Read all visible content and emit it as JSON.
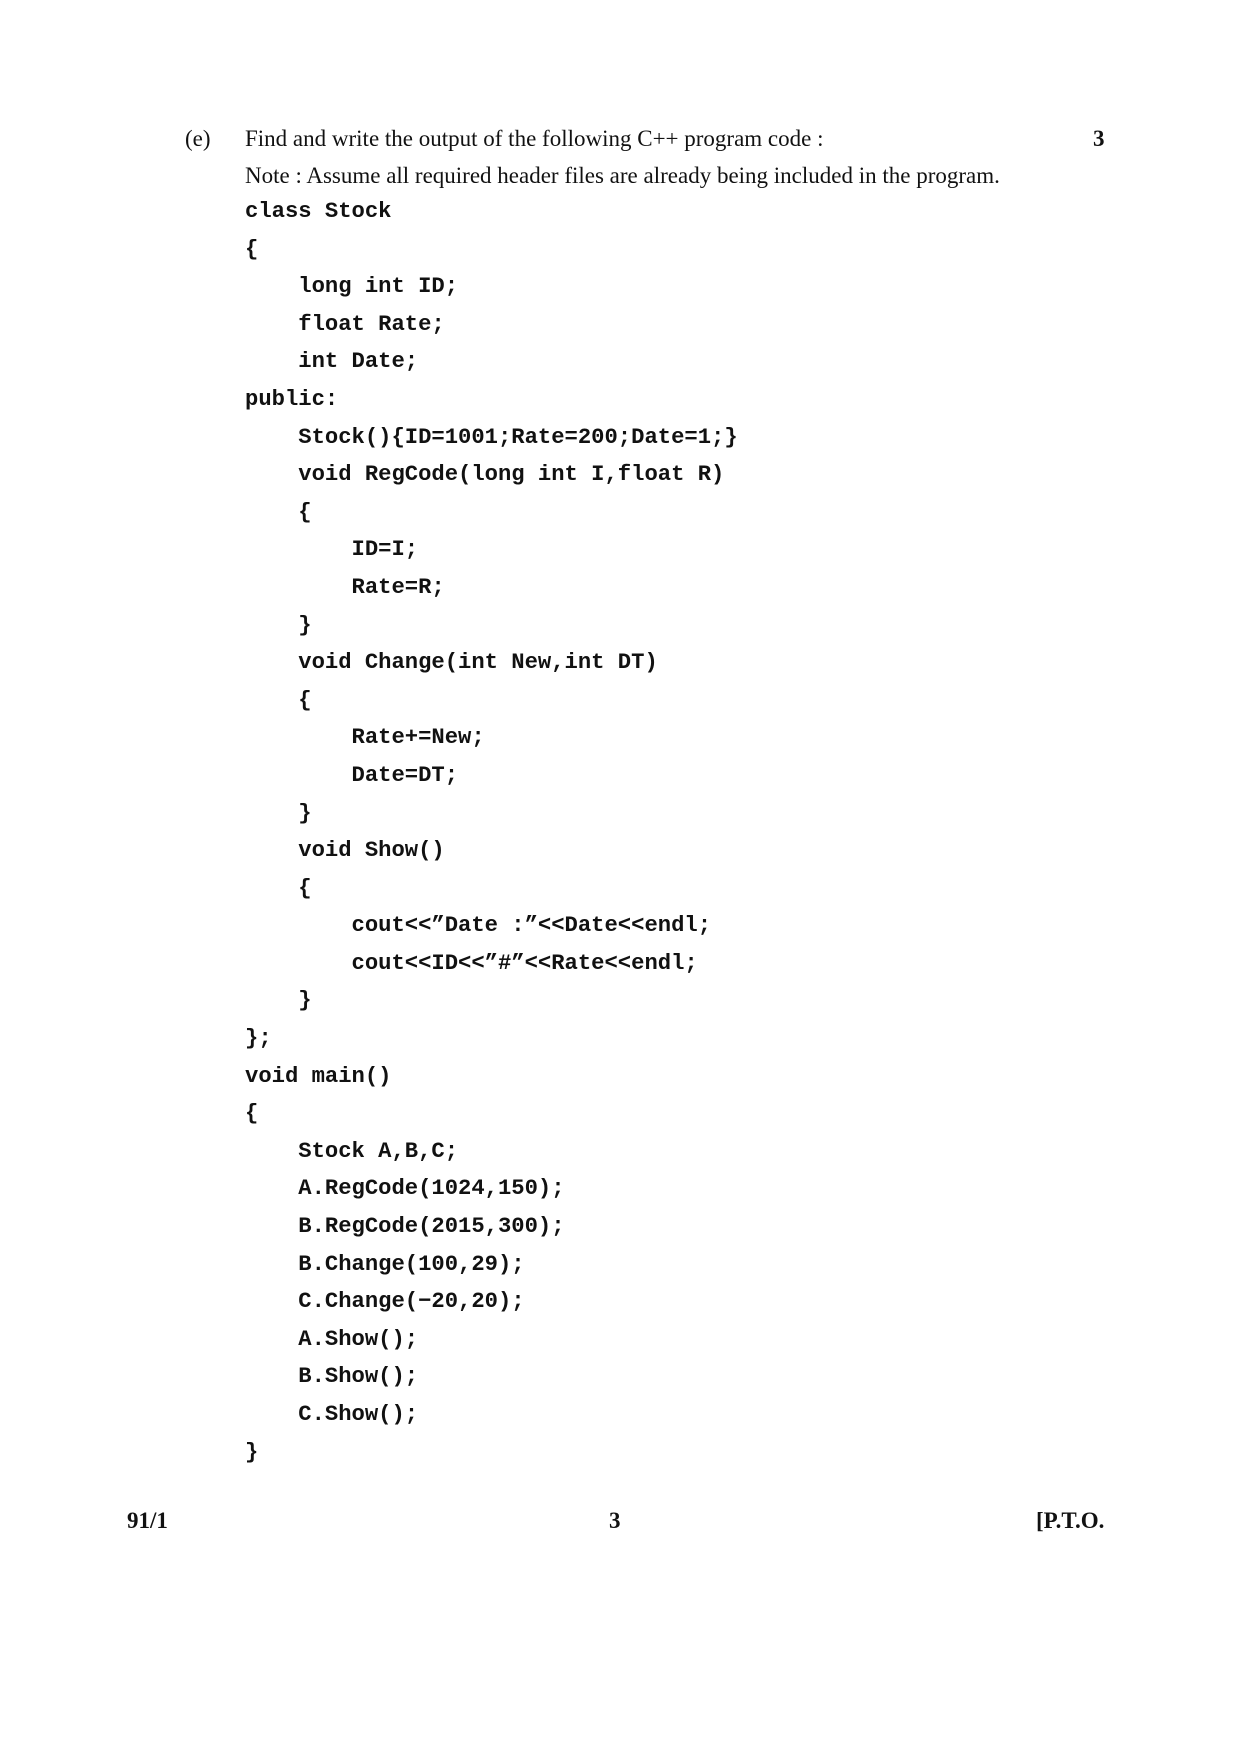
{
  "question": {
    "label": "(e)",
    "marks": "3",
    "instruction": "Find and write the output of the following C++ program code :",
    "note": "Note : Assume all required header files are already being included in the program.",
    "code_lines": [
      "class Stock",
      "{",
      "    long int ID;",
      "    float Rate;",
      "    int Date;",
      "public:",
      "    Stock(){ID=1001;Rate=200;Date=1;}",
      "    void RegCode(long int I,float R)",
      "    {",
      "        ID=I;",
      "        Rate=R;",
      "    }",
      "    void Change(int New,int DT)",
      "    {",
      "        Rate+=New;",
      "        Date=DT;",
      "    }",
      "    void Show()",
      "    {",
      "        cout<<”Date :”<<Date<<endl;",
      "        cout<<ID<<”#”<<Rate<<endl;",
      "    }",
      "};",
      "void main()",
      "{",
      "    Stock A,B,C;",
      "    A.RegCode(1024,150);",
      "    B.RegCode(2015,300);",
      "    B.Change(100,29);",
      "    C.Change(−20,20);",
      "    A.Show();",
      "    B.Show();",
      "    C.Show();",
      "}"
    ]
  },
  "footer": {
    "paper_code": "91/1",
    "page_number": "3",
    "pto": "[P.T.O."
  }
}
